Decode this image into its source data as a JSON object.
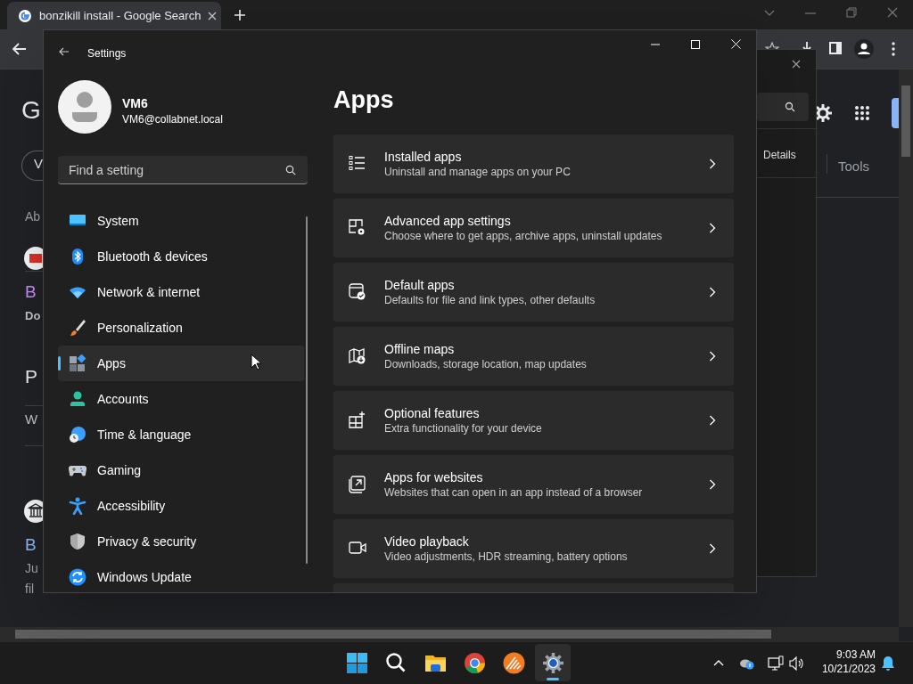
{
  "browser": {
    "tab_title": "bonzikill install - Google Search",
    "fragments": [
      {
        "text": "G",
        "kind": "logo"
      },
      {
        "text": "V",
        "kind": "chip"
      },
      {
        "text": "Ab",
        "kind": "meta"
      },
      {
        "text": "B",
        "kind": "link",
        "visited": true
      },
      {
        "text": "Do",
        "kind": "bold"
      },
      {
        "text": "P",
        "kind": "heading"
      },
      {
        "text": "W",
        "kind": "plain"
      },
      {
        "text": "B",
        "kind": "link",
        "visited": false
      },
      {
        "text": "Ju",
        "kind": "meta"
      },
      {
        "text": "fil",
        "kind": "meta"
      }
    ],
    "tools_label": "Tools"
  },
  "dialog": {
    "tab_label": "Details"
  },
  "settings": {
    "title": "Settings",
    "user": {
      "name": "VM6",
      "email": "VM6@collabnet.local"
    },
    "search": {
      "placeholder": "Find a setting"
    },
    "nav": [
      {
        "label": "System",
        "selected": false
      },
      {
        "label": "Bluetooth & devices",
        "selected": false
      },
      {
        "label": "Network & internet",
        "selected": false
      },
      {
        "label": "Personalization",
        "selected": false
      },
      {
        "label": "Apps",
        "selected": true
      },
      {
        "label": "Accounts",
        "selected": false
      },
      {
        "label": "Time & language",
        "selected": false
      },
      {
        "label": "Gaming",
        "selected": false
      },
      {
        "label": "Accessibility",
        "selected": false
      },
      {
        "label": "Privacy & security",
        "selected": false
      },
      {
        "label": "Windows Update",
        "selected": false
      }
    ],
    "page_title": "Apps",
    "items": [
      {
        "title": "Installed apps",
        "description": "Uninstall and manage apps on your PC"
      },
      {
        "title": "Advanced app settings",
        "description": "Choose where to get apps, archive apps, uninstall updates"
      },
      {
        "title": "Default apps",
        "description": "Defaults for file and link types, other defaults"
      },
      {
        "title": "Offline maps",
        "description": "Downloads, storage location, map updates"
      },
      {
        "title": "Optional features",
        "description": "Extra functionality for your device"
      },
      {
        "title": "Apps for websites",
        "description": "Websites that can open in an app instead of a browser"
      },
      {
        "title": "Video playback",
        "description": "Video adjustments, HDR streaming, battery options"
      }
    ]
  },
  "taskbar": {
    "apps": [
      {
        "kind": "start",
        "selected": false
      },
      {
        "kind": "search",
        "selected": false
      },
      {
        "kind": "folder",
        "selected": false
      },
      {
        "kind": "chrome",
        "selected": false
      },
      {
        "kind": "orange",
        "selected": false
      },
      {
        "kind": "settings",
        "selected": true
      }
    ],
    "time": "9:03 AM",
    "date": "10/21/2023"
  }
}
